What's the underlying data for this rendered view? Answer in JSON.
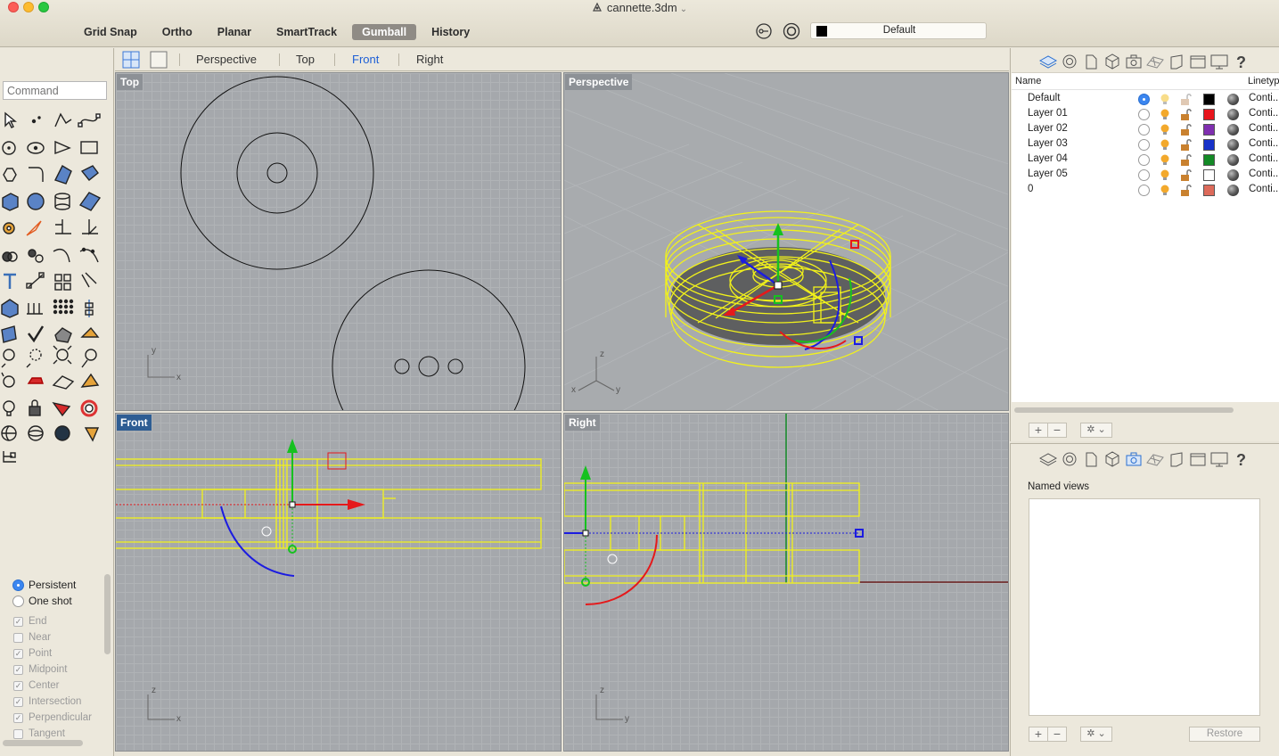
{
  "window": {
    "title": "cannette.3dm"
  },
  "toolbar": {
    "toggles": [
      {
        "label": "Grid Snap",
        "active": false
      },
      {
        "label": "Ortho",
        "active": false
      },
      {
        "label": "Planar",
        "active": false
      },
      {
        "label": "SmartTrack",
        "active": false
      },
      {
        "label": "Gumball",
        "active": true
      },
      {
        "label": "History",
        "active": false
      }
    ],
    "current_layer": "Default",
    "current_layer_color": "#000000"
  },
  "command": {
    "placeholder": "Command"
  },
  "viewport_tabs": {
    "items": [
      "Perspective",
      "Top",
      "Front",
      "Right"
    ],
    "active": "Front"
  },
  "viewports": {
    "top": {
      "label": "Top"
    },
    "perspective": {
      "label": "Perspective"
    },
    "front": {
      "label": "Front"
    },
    "right": {
      "label": "Right"
    }
  },
  "osnap": {
    "modes": [
      {
        "label": "Persistent",
        "selected": true
      },
      {
        "label": "One shot",
        "selected": false
      }
    ],
    "items": [
      {
        "label": "End",
        "checked": true
      },
      {
        "label": "Near",
        "checked": false
      },
      {
        "label": "Point",
        "checked": true
      },
      {
        "label": "Midpoint",
        "checked": true
      },
      {
        "label": "Center",
        "checked": true
      },
      {
        "label": "Intersection",
        "checked": true
      },
      {
        "label": "Perpendicular",
        "checked": true
      },
      {
        "label": "Tangent",
        "checked": false
      }
    ]
  },
  "layers_panel": {
    "headers": {
      "name": "Name",
      "linetype": "Linetyp"
    },
    "rows": [
      {
        "name": "Default",
        "current": true,
        "color": "#000000",
        "linetype": "Conti..."
      },
      {
        "name": "Layer 01",
        "current": false,
        "color": "#e8141c",
        "linetype": "Conti..."
      },
      {
        "name": "Layer 02",
        "current": false,
        "color": "#7f2fb0",
        "linetype": "Conti..."
      },
      {
        "name": "Layer 03",
        "current": false,
        "color": "#1732c9",
        "linetype": "Conti..."
      },
      {
        "name": "Layer 04",
        "current": false,
        "color": "#138a26",
        "linetype": "Conti..."
      },
      {
        "name": "Layer 05",
        "current": false,
        "color": "#ffffff",
        "linetype": "Conti..."
      },
      {
        "name": "0",
        "current": false,
        "color": "#dd6a5a",
        "linetype": "Conti..."
      }
    ],
    "add_label": "+",
    "remove_label": "−"
  },
  "named_views_panel": {
    "title": "Named views",
    "restore_label": "Restore",
    "add_label": "+",
    "remove_label": "−"
  },
  "axis_labels": {
    "x": "x",
    "y": "y",
    "z": "z"
  },
  "colors": {
    "selection": "#f2f21a",
    "gumball_x": "#e5191b",
    "gumball_y": "#16c11f",
    "gumball_z": "#1c1ce0",
    "active_accent": "#1d5fd6"
  }
}
